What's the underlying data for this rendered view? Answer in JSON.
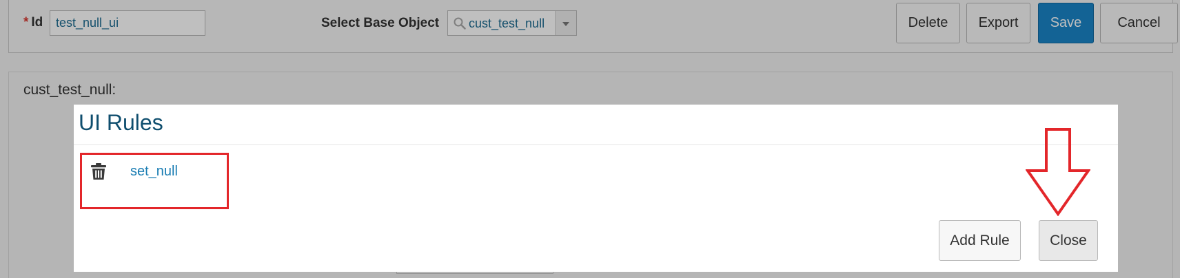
{
  "header": {
    "id_label": "Id",
    "required_mark": "*",
    "id_value": "test_null_ui",
    "select_base_object_label": "Select Base Object",
    "base_object_value": "cust_test_null",
    "buttons": {
      "delete": "Delete",
      "export": "Export",
      "save": "Save",
      "cancel": "Cancel"
    }
  },
  "section": {
    "title": "cust_test_null:"
  },
  "modal": {
    "title": "UI Rules",
    "rules": [
      {
        "name": "set_null",
        "delete_icon": "trash-icon"
      }
    ],
    "buttons": {
      "add_rule": "Add Rule",
      "close": "Close"
    }
  },
  "colors": {
    "primary_button": "#1a84c7",
    "link": "#1a7db3",
    "modal_title": "#0f4e6e",
    "annotation": "#e3262a"
  }
}
